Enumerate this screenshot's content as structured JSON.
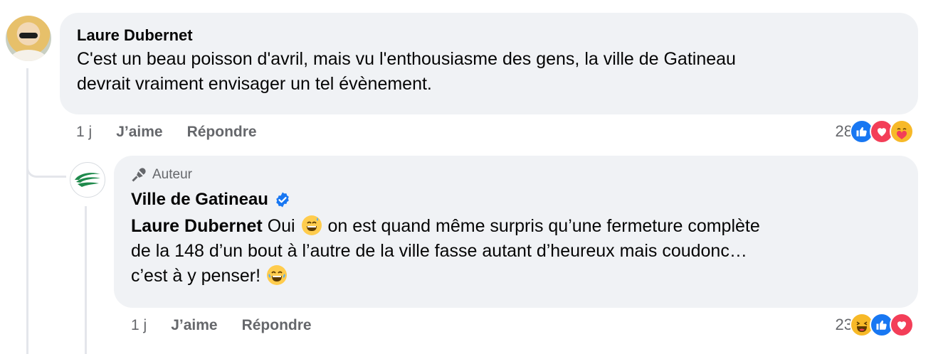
{
  "comments": [
    {
      "author": "Laure Dubernet",
      "text_line1": "C'est un beau poisson d'avril, mais vu l'enthousiasme des gens, la ville de Gatineau",
      "text_line2": "devrait vraiment envisager un tel évènement.",
      "time": "1 j",
      "like_label": "J’aime",
      "reply_label": "Répondre",
      "reaction_count": "28",
      "reactions": [
        "like",
        "love",
        "care"
      ]
    }
  ],
  "reply": {
    "badge_icon": "microphone-icon",
    "badge_label": "Auteur",
    "author": "Ville de Gatineau",
    "verified_icon": "verified-badge-icon",
    "mention": "Laure Dubernet",
    "text_line1_after_mention": " Oui ",
    "text_line1_after_emoji": " on est quand même surpris qu’une fermeture complète",
    "text_line2": "de la 148 d’un bout à l’autre de la ville fasse autant d’heureux mais coudonc…",
    "text_line3": "c’est à y penser! ",
    "emoji_1": "grinning-sweat-emoji",
    "emoji_2": "tears-of-joy-emoji",
    "time": "1 j",
    "like_label": "J’aime",
    "reply_label": "Répondre",
    "reaction_count": "23",
    "reactions": [
      "haha",
      "like",
      "love"
    ]
  },
  "colors": {
    "bubble": "#f0f2f5",
    "meta_text": "#65676b",
    "like_blue": "#1877f2",
    "love_red": "#f33e58",
    "emoji_yellow": "#f7b928",
    "verified_blue": "#1877f2",
    "gatineau_green": "#1f8a4c"
  }
}
